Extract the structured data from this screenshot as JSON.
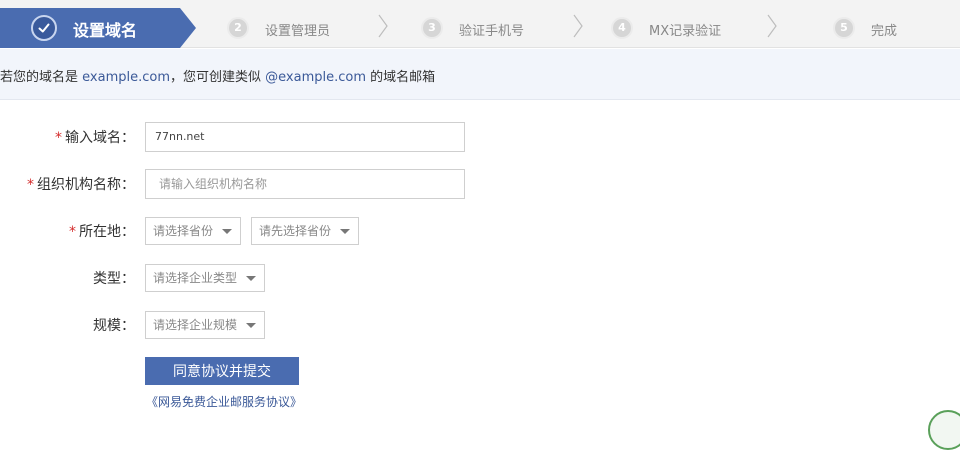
{
  "steps": {
    "active": {
      "label": "设置域名"
    },
    "items": [
      {
        "number": "2",
        "label": "设置管理员"
      },
      {
        "number": "3",
        "label": "验证手机号"
      },
      {
        "number": "4",
        "label": "MX记录验证"
      },
      {
        "number": "5",
        "label": "完成"
      }
    ]
  },
  "info": {
    "prefix": "若您的域名是 ",
    "domain": "example.com",
    "middle": "，您可创建类似 ",
    "email": "@example.com",
    "suffix": " 的域名邮箱"
  },
  "form": {
    "domain_label": "输入域名：",
    "domain_value": "77nn.net",
    "org_label": "组织机构名称：",
    "org_placeholder": "请输入组织机构名称",
    "location_label": "所在地：",
    "province_placeholder": "请选择省份",
    "city_placeholder": "请先选择省份",
    "type_label": "类型：",
    "type_placeholder": "请选择企业类型",
    "scale_label": "规模：",
    "scale_placeholder": "请选择企业规模",
    "required_mark": "*"
  },
  "actions": {
    "submit_label": "同意协议并提交",
    "agreement_link": "《网易免费企业邮服务协议》"
  },
  "colors": {
    "accent": "#4a6cb0",
    "link": "#3b5998",
    "required": "#d42b2b"
  }
}
